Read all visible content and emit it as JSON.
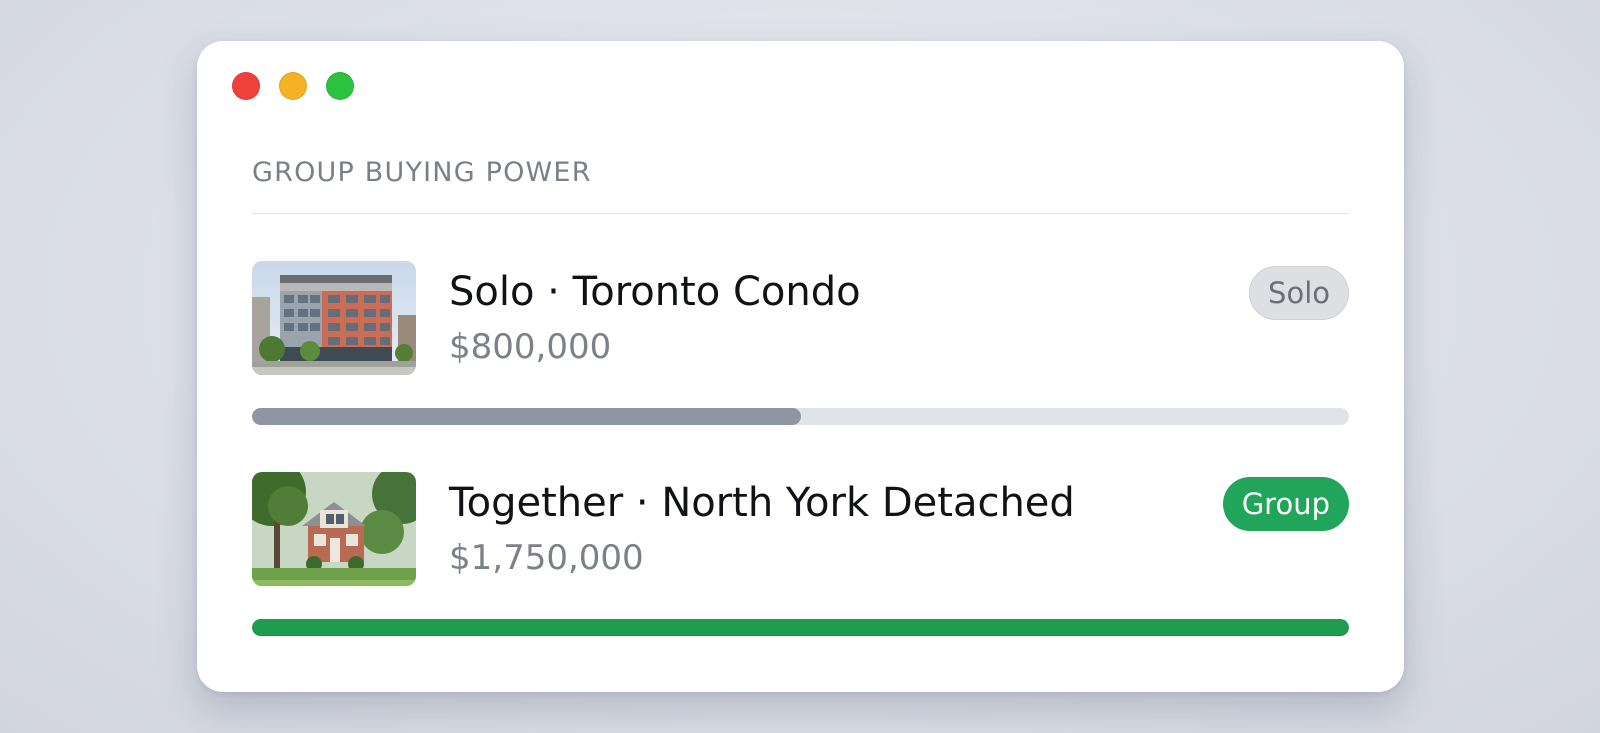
{
  "window": {
    "controls": [
      "close",
      "minimize",
      "maximize"
    ]
  },
  "section": {
    "title": "GROUP BUYING POWER"
  },
  "listings": [
    {
      "title": "Solo · Toronto Condo",
      "price": "$800,000",
      "badge": "Solo",
      "image_icon": "condo-building-photo",
      "progress": 0.5
    },
    {
      "title": "Together · North York Detached",
      "price": "$1,750,000",
      "badge": "Group",
      "image_icon": "detached-house-photo",
      "progress": 1.0
    }
  ],
  "colors": {
    "solo_bar": "#8e95a3",
    "group_bar": "#1f9d4f",
    "group_badge": "#20a55a",
    "track": "#e1e3e8"
  }
}
